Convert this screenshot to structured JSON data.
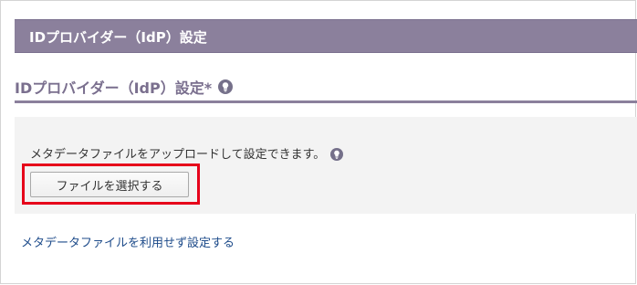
{
  "header": {
    "title": "IDプロバイダー（IdP）設定"
  },
  "section": {
    "title": "IDプロバイダー（IdP）設定*",
    "hint_icon": "hint-icon"
  },
  "panel": {
    "description": "メタデータファイルをアップロードして設定できます。",
    "hint_icon": "hint-icon",
    "file_button_label": "ファイルを選択する"
  },
  "link": {
    "label": "メタデータファイルを利用せず設定する"
  },
  "colors": {
    "header_bg": "#8b809c",
    "section_title": "#7a6f8e",
    "panel_bg": "#f3f3f3",
    "highlight": "#e6001a",
    "link": "#1d4b8a"
  }
}
